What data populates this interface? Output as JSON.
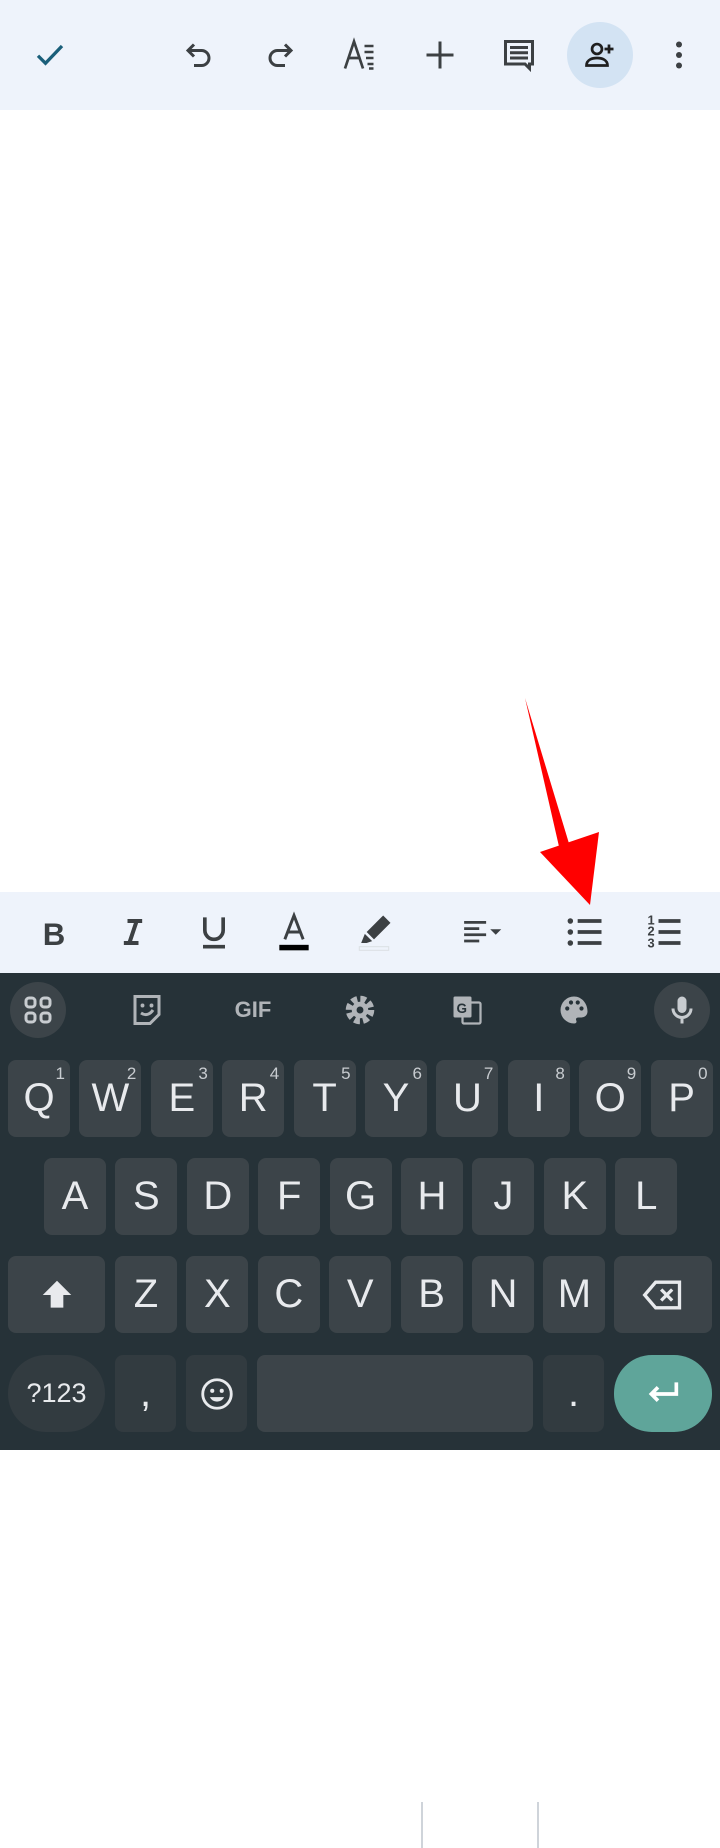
{
  "toolbar": {
    "icons": [
      "check-icon",
      "undo-icon",
      "redo-icon",
      "text-format-icon",
      "insert-icon",
      "comment-icon",
      "share-icon",
      "more-icon"
    ]
  },
  "format_bar": {
    "icons": [
      "bold-icon",
      "italic-icon",
      "underline-icon",
      "text-color-icon",
      "highlight-icon",
      "align-icon",
      "bulleted-list-icon",
      "numbered-list-icon"
    ],
    "text_color": "#000000"
  },
  "keyboard": {
    "gif_label": "GIF",
    "row1": [
      {
        "k": "Q",
        "h": "1"
      },
      {
        "k": "W",
        "h": "2"
      },
      {
        "k": "E",
        "h": "3"
      },
      {
        "k": "R",
        "h": "4"
      },
      {
        "k": "T",
        "h": "5"
      },
      {
        "k": "Y",
        "h": "6"
      },
      {
        "k": "U",
        "h": "7"
      },
      {
        "k": "I",
        "h": "8"
      },
      {
        "k": "O",
        "h": "9"
      },
      {
        "k": "P",
        "h": "0"
      }
    ],
    "row2": [
      "A",
      "S",
      "D",
      "F",
      "G",
      "H",
      "J",
      "K",
      "L"
    ],
    "row3": [
      "Z",
      "X",
      "C",
      "V",
      "B",
      "N",
      "M"
    ],
    "symbols_label": "?123",
    "comma": ",",
    "period": ".",
    "enter_color": "#5fa59a"
  },
  "annotation": {
    "color": "#ff0000"
  }
}
